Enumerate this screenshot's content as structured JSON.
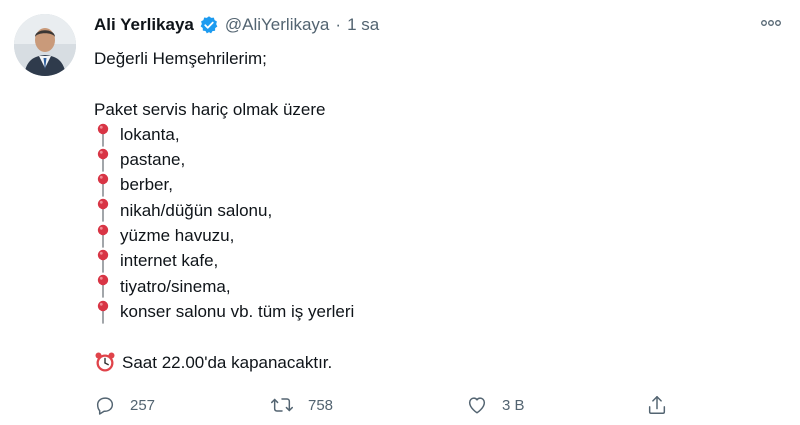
{
  "tweet": {
    "author_name": "Ali Yerlikaya",
    "handle": "@AliYerlikaya",
    "separator": "·",
    "time": "1 sa",
    "lines": [
      "Değerli Hemşehrilerim;",
      "",
      "Paket servis hariç olmak üzere"
    ],
    "bullet_items": [
      "lokanta,",
      "pastane,",
      "berber,",
      "nikah/düğün salonu,",
      "yüzme havuzu,",
      "internet kafe,",
      "tiyatro/sinema,",
      "konser salonu vb. tüm iş yerleri"
    ],
    "closing_line": "Saat 22.00'da kapanacaktır."
  },
  "actions": {
    "reply_count": "257",
    "retweet_count": "758",
    "like_count": "3 B"
  },
  "icons": {
    "verified": "verified-badge-icon",
    "more": "more-options-icon",
    "bullet": "round-pushpin-emoji",
    "clock": "alarm-clock-emoji",
    "reply": "reply-icon",
    "retweet": "retweet-icon",
    "like": "heart-icon",
    "share": "share-icon"
  },
  "colors": {
    "verified_blue": "#1d9bf0",
    "secondary_text": "#536471",
    "pin_red": "#d83545",
    "clock_red": "#e0434a"
  }
}
